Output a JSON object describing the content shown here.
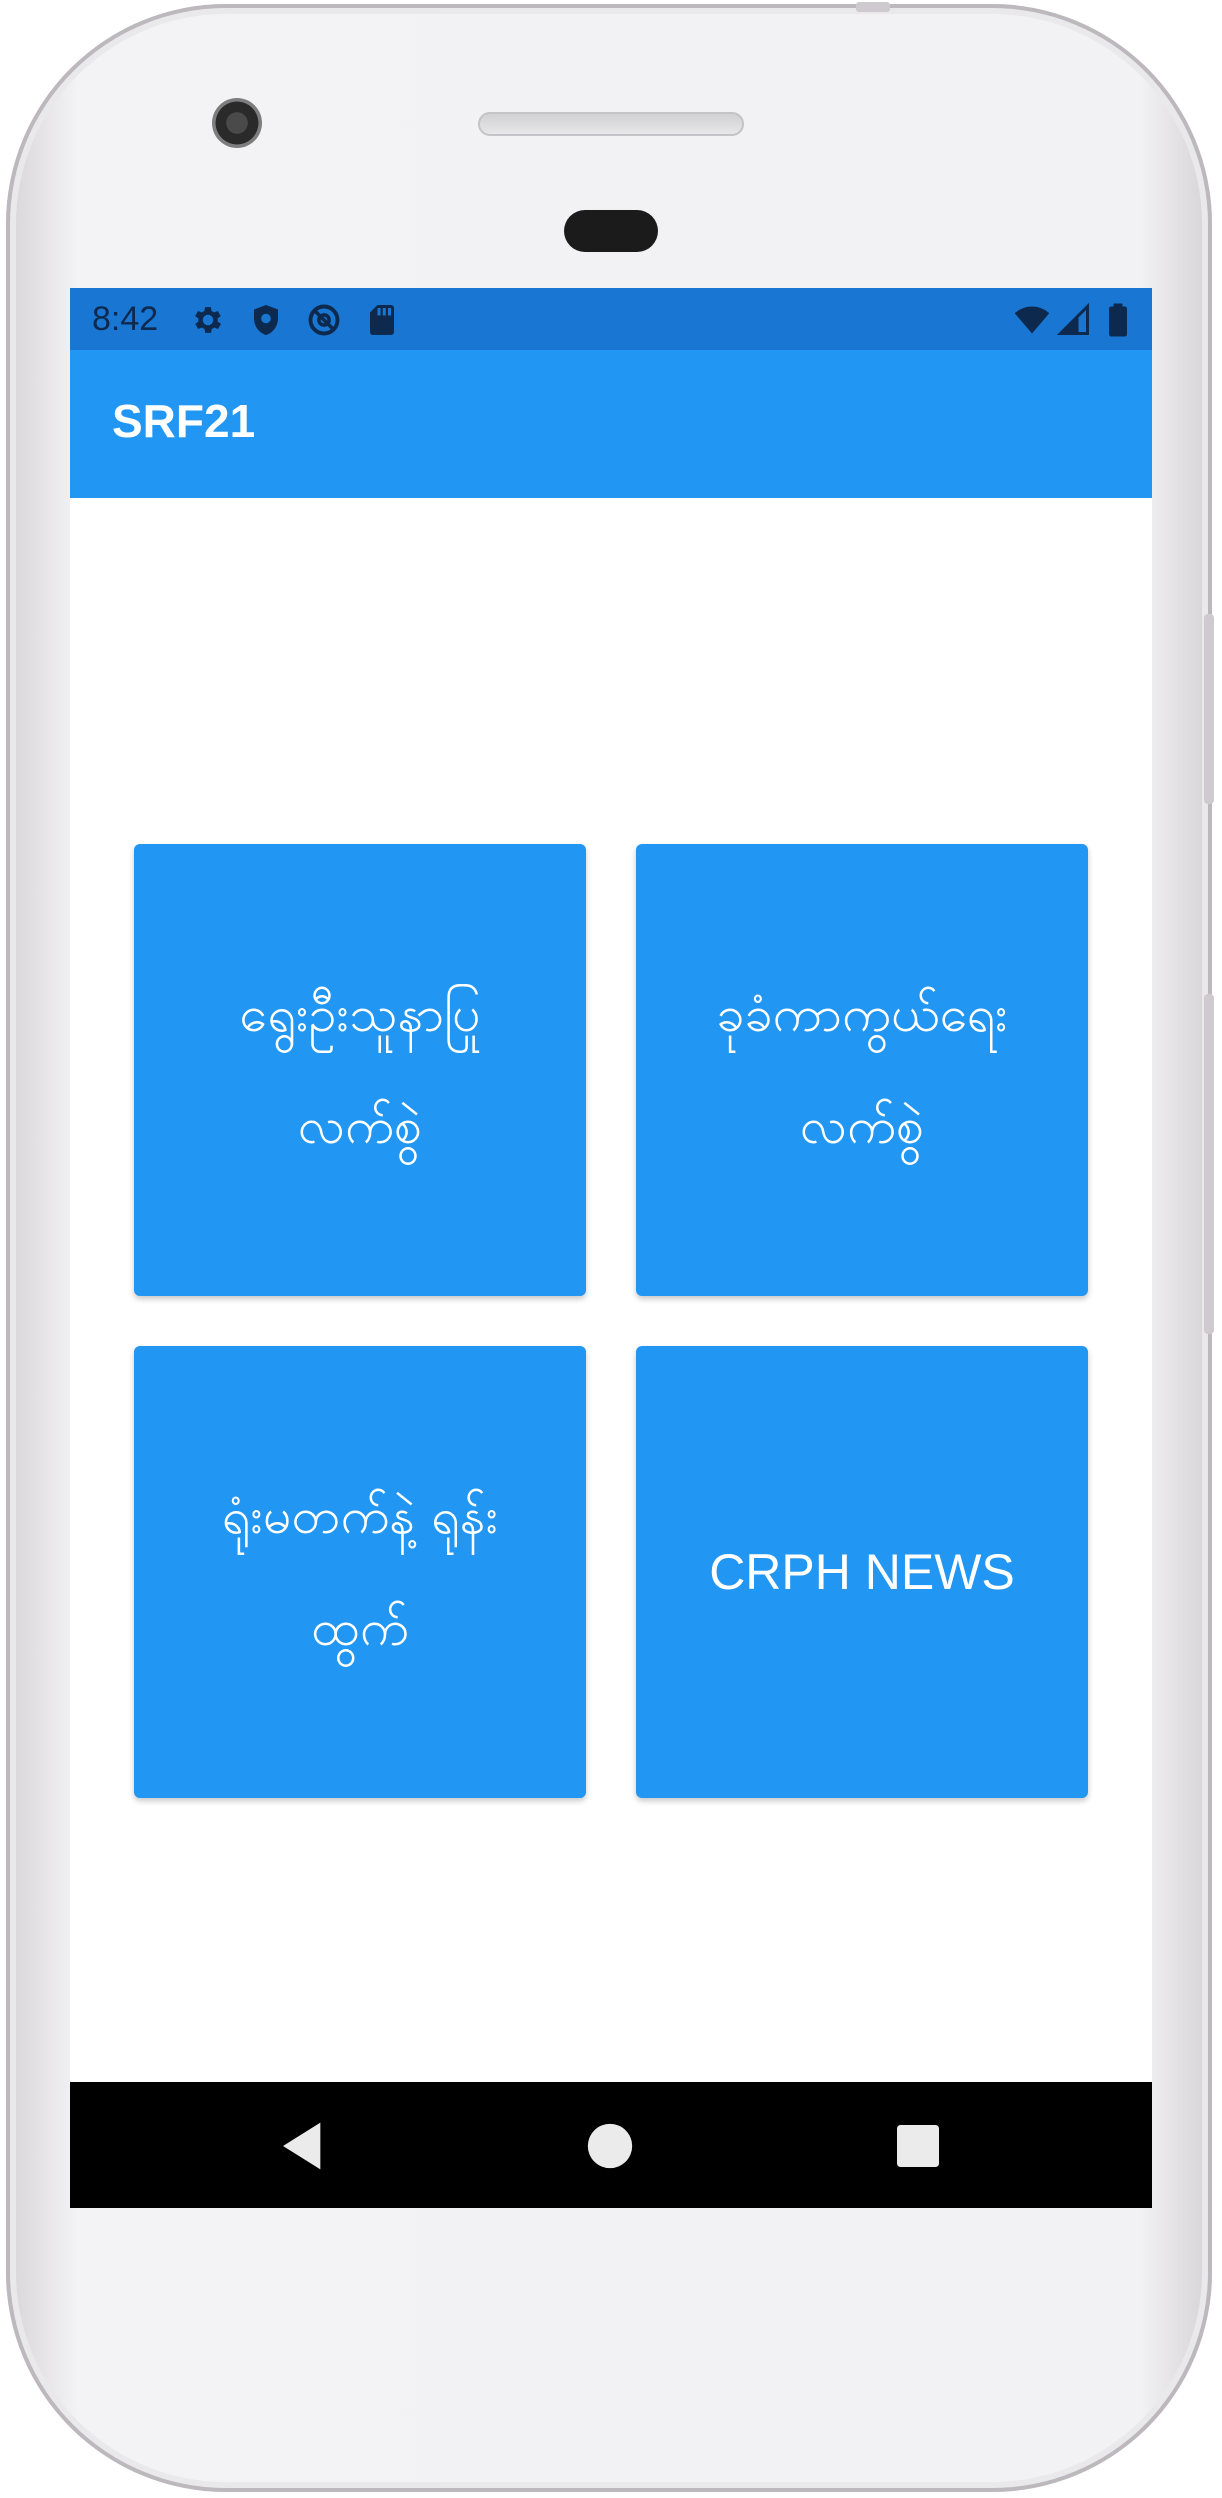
{
  "status_bar": {
    "time": "8:42",
    "left_icons": [
      "gear-icon",
      "shield-icon",
      "at-sign-icon",
      "sd-card-icon"
    ],
    "right_icons": [
      "wifi-icon",
      "cellular-signal-icon",
      "battery-icon"
    ]
  },
  "app_bar": {
    "title": "SRF21"
  },
  "tiles": [
    {
      "label": "ရွေးဦးသူနာပြု လက်စွဲ"
    },
    {
      "label": "ခုခံကာကွယ်ရေး လက်စွဲ"
    },
    {
      "label": "ရုံးမတက်နဲ့ ရုန်းထွက်"
    },
    {
      "label": "CRPH NEWS"
    }
  ],
  "nav_bar": {
    "icons": [
      "back-triangle-icon",
      "home-circle-icon",
      "recents-square-icon"
    ]
  },
  "colors": {
    "status_bar": "#1976d2",
    "app_bar": "#2196f3",
    "tile": "#2196f3",
    "nav_bar": "#000000"
  }
}
